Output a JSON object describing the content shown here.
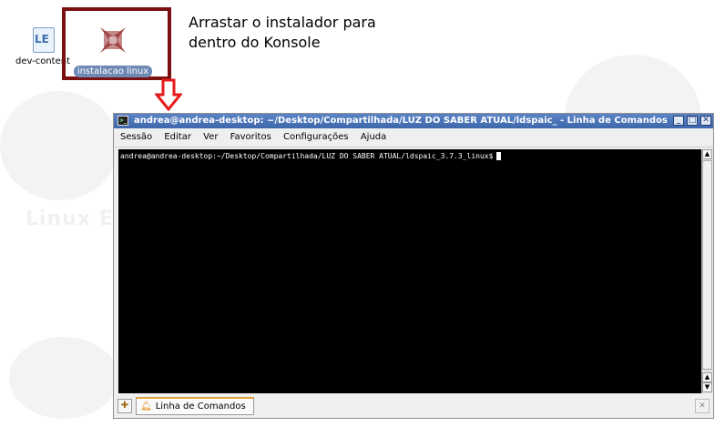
{
  "desktop": {
    "icons": [
      {
        "label": "dev-content"
      },
      {
        "label": "instalacao linux"
      }
    ],
    "instruction_line1": "Arrastar o instalador para",
    "instruction_line2": "dentro do Konsole"
  },
  "window": {
    "title": "andrea@andrea-desktop: ~/Desktop/Compartilhada/LUZ DO SABER ATUAL/ldspaic_ - Linha de Comandos",
    "menu": [
      "Sessão",
      "Editar",
      "Ver",
      "Favoritos",
      "Configurações",
      "Ajuda"
    ],
    "terminal": {
      "prompt": "andrea@andrea-desktop:~/Desktop/Compartilhada/LUZ DO SABER ATUAL/ldspaic_3.7.3_linux$"
    },
    "tabs": [
      {
        "label": "Linha de Comandos"
      }
    ]
  },
  "colors": {
    "highlight_border": "#7b1010",
    "arrow": "#e41b1b",
    "titlebar": "#4a74b8",
    "terminal_bg": "#000000"
  }
}
